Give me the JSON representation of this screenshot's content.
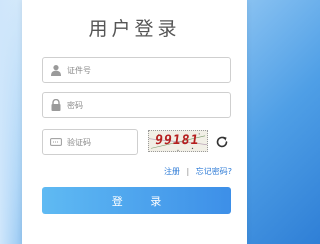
{
  "login": {
    "title": "用户登录",
    "username_placeholder": "证件号",
    "password_placeholder": "密码",
    "captcha_placeholder": "验证码",
    "captcha_code": "99181",
    "register_link": "注册",
    "link_separator": "|",
    "forgot_password_link": "忘记密码?",
    "submit_label": "登 录"
  },
  "icons": {
    "username": "user-icon",
    "password": "lock-icon",
    "captcha": "captcha-icon",
    "refresh": "refresh-icon"
  },
  "colors": {
    "button_start": "#5fbaf3",
    "button_end": "#3d8fe8",
    "link": "#2c7ad6",
    "captcha_text": "#b51f1f",
    "background": "#4f9fe6"
  }
}
